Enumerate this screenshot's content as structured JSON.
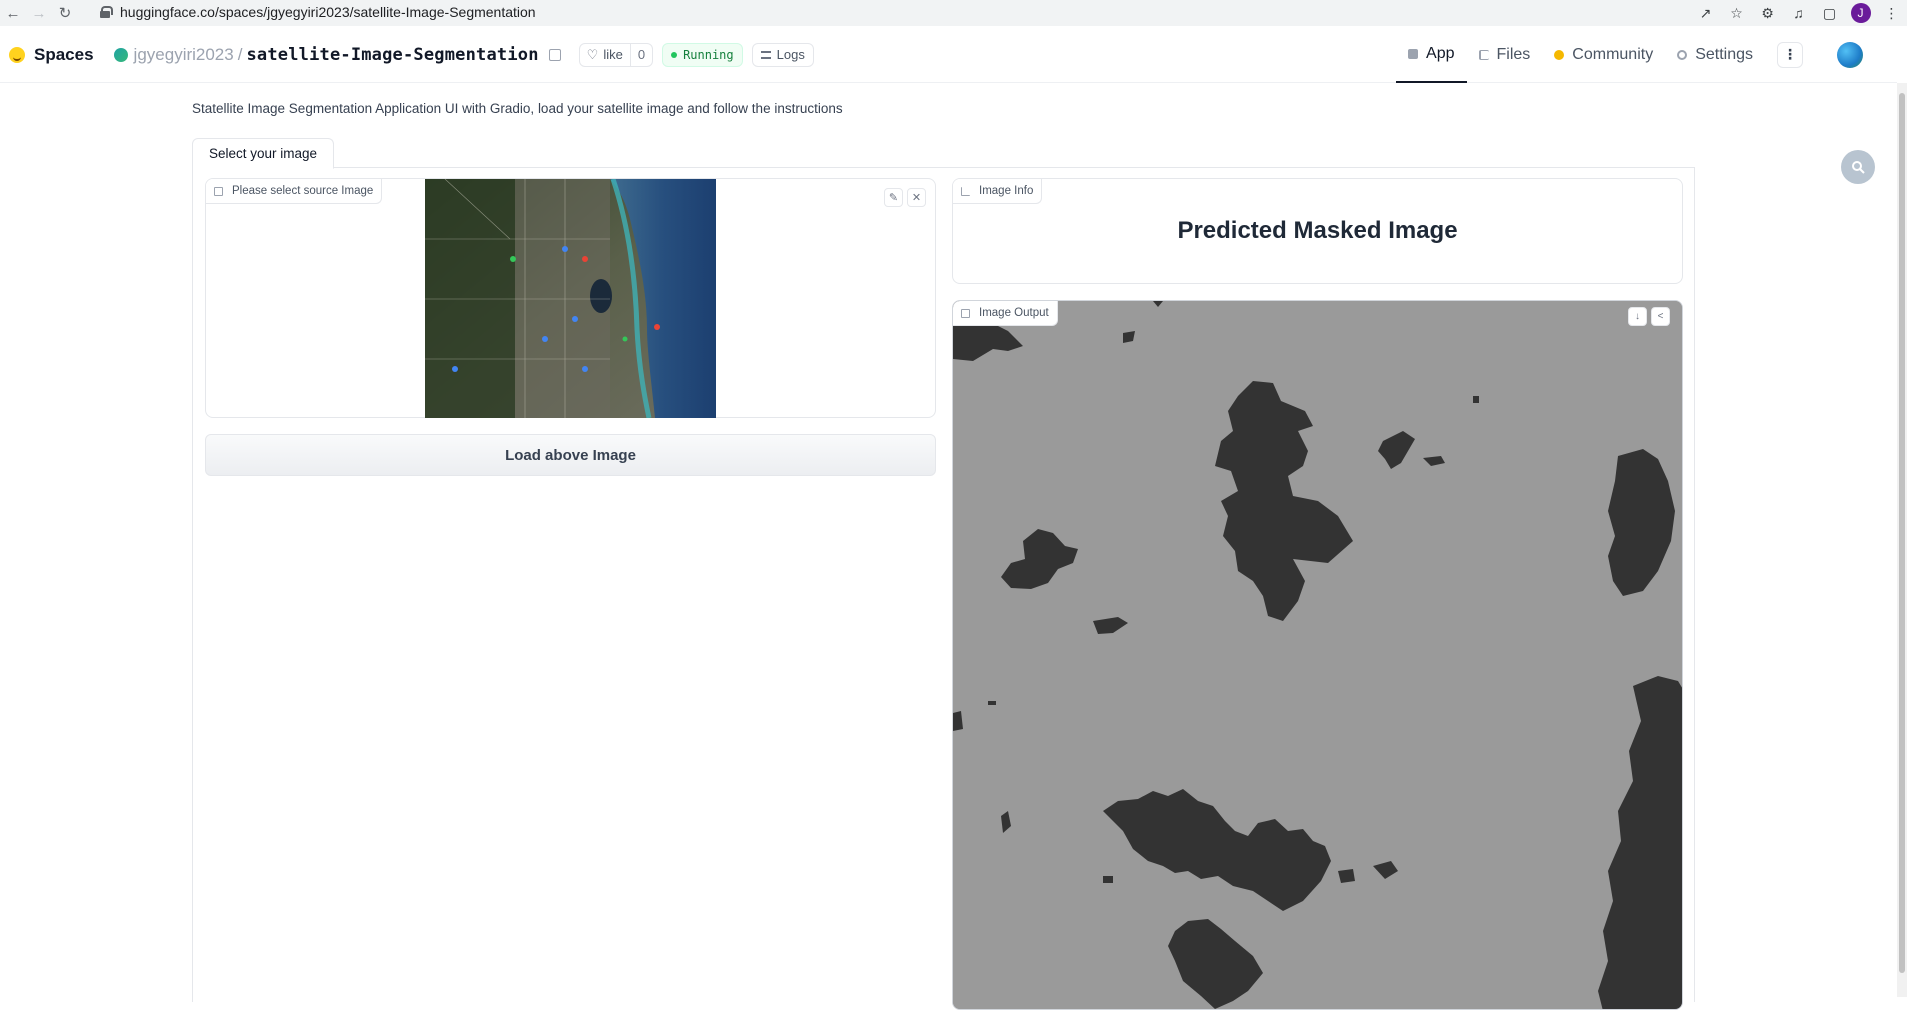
{
  "browser": {
    "url": "huggingface.co/spaces/jgyegyiri2023/satellite-Image-Segmentation",
    "profile_initial": "J"
  },
  "header": {
    "spaces_label": "Spaces",
    "owner": "jgyegyiri2023",
    "separator": "/",
    "repo": "satellite-Image-Segmentation",
    "like_label": "like",
    "like_count": "0",
    "status": "Running",
    "logs_label": "Logs",
    "tabs": [
      {
        "label": "App",
        "active": true
      },
      {
        "label": "Files",
        "active": false
      },
      {
        "label": "Community",
        "active": false
      },
      {
        "label": "Settings",
        "active": false
      }
    ]
  },
  "app": {
    "description": "Statellite Image Segmentation Application UI with Gradio, load your satellite image and follow the instructions",
    "tab_label": "Select your image",
    "input_label": "Please select source Image",
    "load_button": "Load above Image",
    "info_label": "Image Info",
    "info_title": "Predicted Masked Image",
    "output_label": "Image Output"
  },
  "colors": {
    "mask_background": "#9a9a9a",
    "mask_foreground": "#333333",
    "running_green": "#22c55e"
  }
}
